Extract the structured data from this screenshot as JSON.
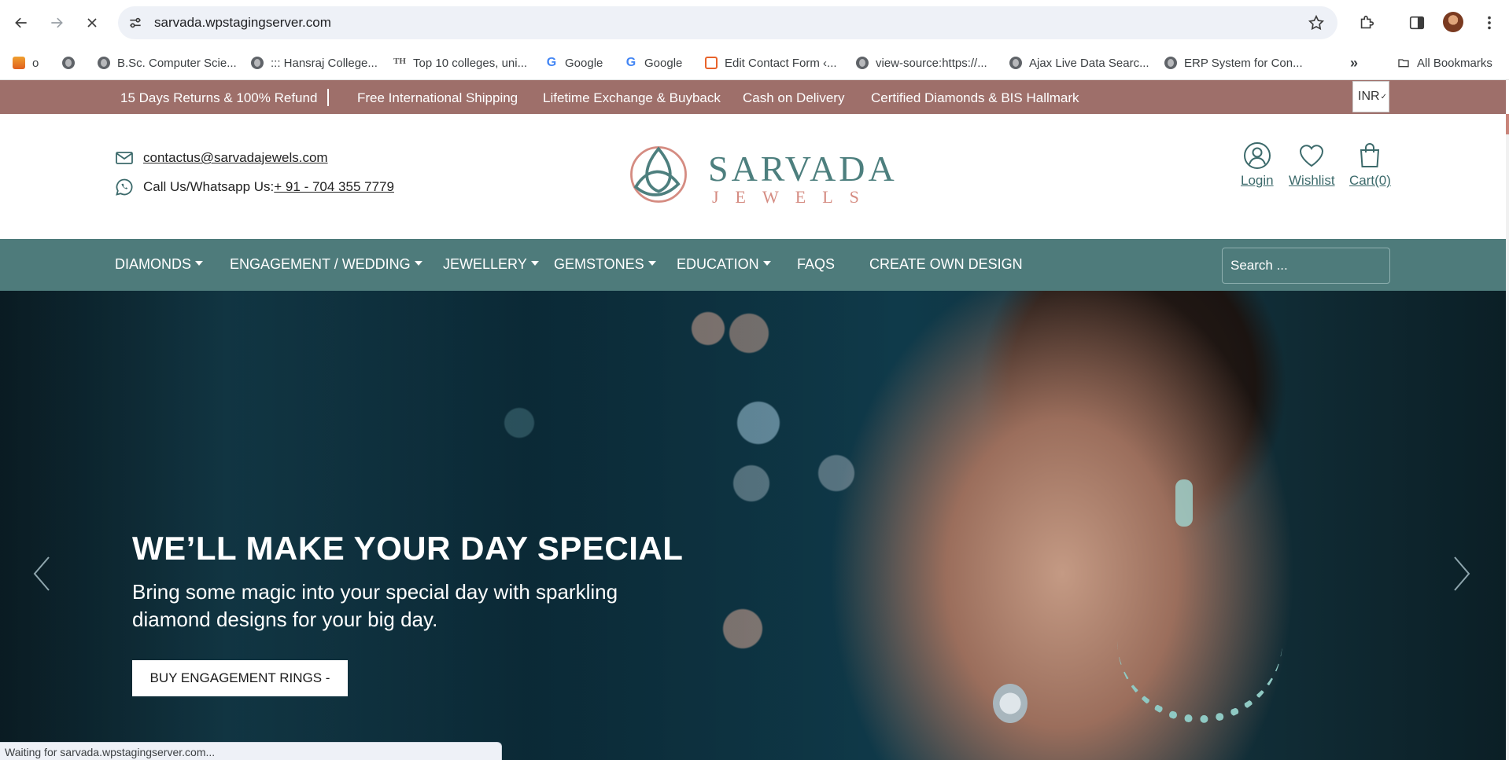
{
  "browser": {
    "url": "sarvada.wpstagingserver.com",
    "bookmarks": [
      {
        "label": "o",
        "icon": "fire-icon"
      },
      {
        "label": "",
        "icon": "globe-icon"
      },
      {
        "label": "B.Sc. Computer Scie...",
        "icon": "globe-icon"
      },
      {
        "label": "::: Hansraj College...",
        "icon": "globe-icon"
      },
      {
        "label": "Top 10 colleges, uni...",
        "icon": "site-icon"
      },
      {
        "label": "Google",
        "icon": "google-icon"
      },
      {
        "label": "Google",
        "icon": "google-icon"
      },
      {
        "label": "Edit Contact Form ‹...",
        "icon": "xampp-icon"
      },
      {
        "label": "view-source:https://...",
        "icon": "globe-icon"
      },
      {
        "label": "Ajax Live Data Searc...",
        "icon": "globe-icon"
      },
      {
        "label": "ERP System for Con...",
        "icon": "globe-icon"
      }
    ],
    "all_bookmarks": "All Bookmarks",
    "status_text": "Waiting for sarvada.wpstagingserver.com..."
  },
  "promo": {
    "items": [
      "15 Days Returns & 100% Refund",
      "Free International Shipping",
      "Lifetime Exchange & Buyback",
      "Cash on Delivery",
      "Certified Diamonds & BIS Hallmark"
    ],
    "currency": "INR"
  },
  "header": {
    "email": "contactus@sarvadajewels.com",
    "phone_label": "Call Us/Whatsapp Us:",
    "phone": "+ 91 - 704 355 7779",
    "logo_word": "SARVADA",
    "logo_sub": "JEWELS",
    "login": "Login",
    "wishlist": "Wishlist",
    "cart": "Cart(0)"
  },
  "nav": {
    "items": [
      {
        "label": "DIAMONDS",
        "dropdown": true
      },
      {
        "label": "ENGAGEMENT / WEDDING",
        "dropdown": true
      },
      {
        "label": "JEWELLERY",
        "dropdown": true
      },
      {
        "label": "GEMSTONES",
        "dropdown": true
      },
      {
        "label": "EDUCATION",
        "dropdown": true
      },
      {
        "label": "FAQS",
        "dropdown": false
      },
      {
        "label": "CREATE OWN DESIGN",
        "dropdown": false
      }
    ],
    "search_placeholder": "Search ..."
  },
  "hero": {
    "title": "WE’LL MAKE YOUR DAY SPECIAL",
    "subtitle": "Bring some magic into your special day with sparkling diamond designs for your big day.",
    "cta": "BUY ENGAGEMENT RINGS -"
  },
  "colors": {
    "promo_bg": "#9e6f6a",
    "nav_bg": "#4e7b7b",
    "brand_teal": "#4d7f7e",
    "brand_rose": "#d58c82"
  }
}
